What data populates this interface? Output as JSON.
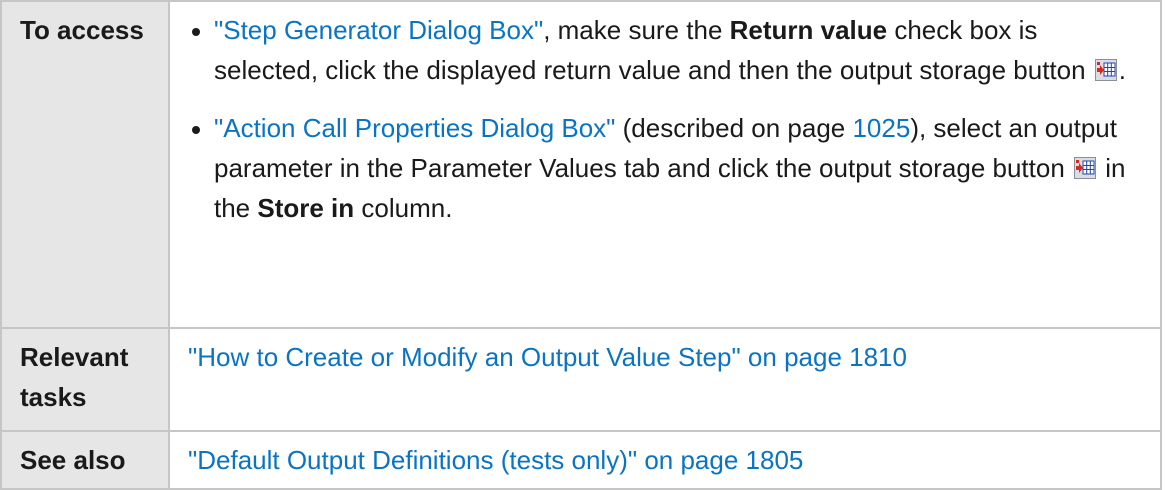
{
  "rows": {
    "access": {
      "label": "To access",
      "bullet1": {
        "link": "\"Step Generator Dialog Box\"",
        "t1": ", make sure the ",
        "b1": "Return value",
        "t2": " check box is selected, click the displayed return value and then the output storage button ",
        "t3": "."
      },
      "bullet2": {
        "link": "\"Action Call Properties Dialog Box\"",
        "t1": " (described on page ",
        "page_link": "1025",
        "t2": "), select an output parameter in the Parameter Values tab and click the output storage button ",
        "t3": " in the ",
        "b1": "Store in",
        "t4": " column."
      },
      "icon": "output-storage-icon"
    },
    "tasks": {
      "label": "Relevant tasks",
      "link": "\"How to Create or Modify an Output Value Step\" on page 1810"
    },
    "see_also": {
      "label": "See also",
      "link": "\"Default Output Definitions (tests only)\" on page 1805"
    }
  },
  "colors": {
    "link": "#0a74c4",
    "header_bg": "#e6e6e6",
    "border": "#c6c6c6",
    "icon_red": "#d62a1e",
    "icon_grid": "#1f44b8",
    "icon_bg": "#d9dde4"
  }
}
